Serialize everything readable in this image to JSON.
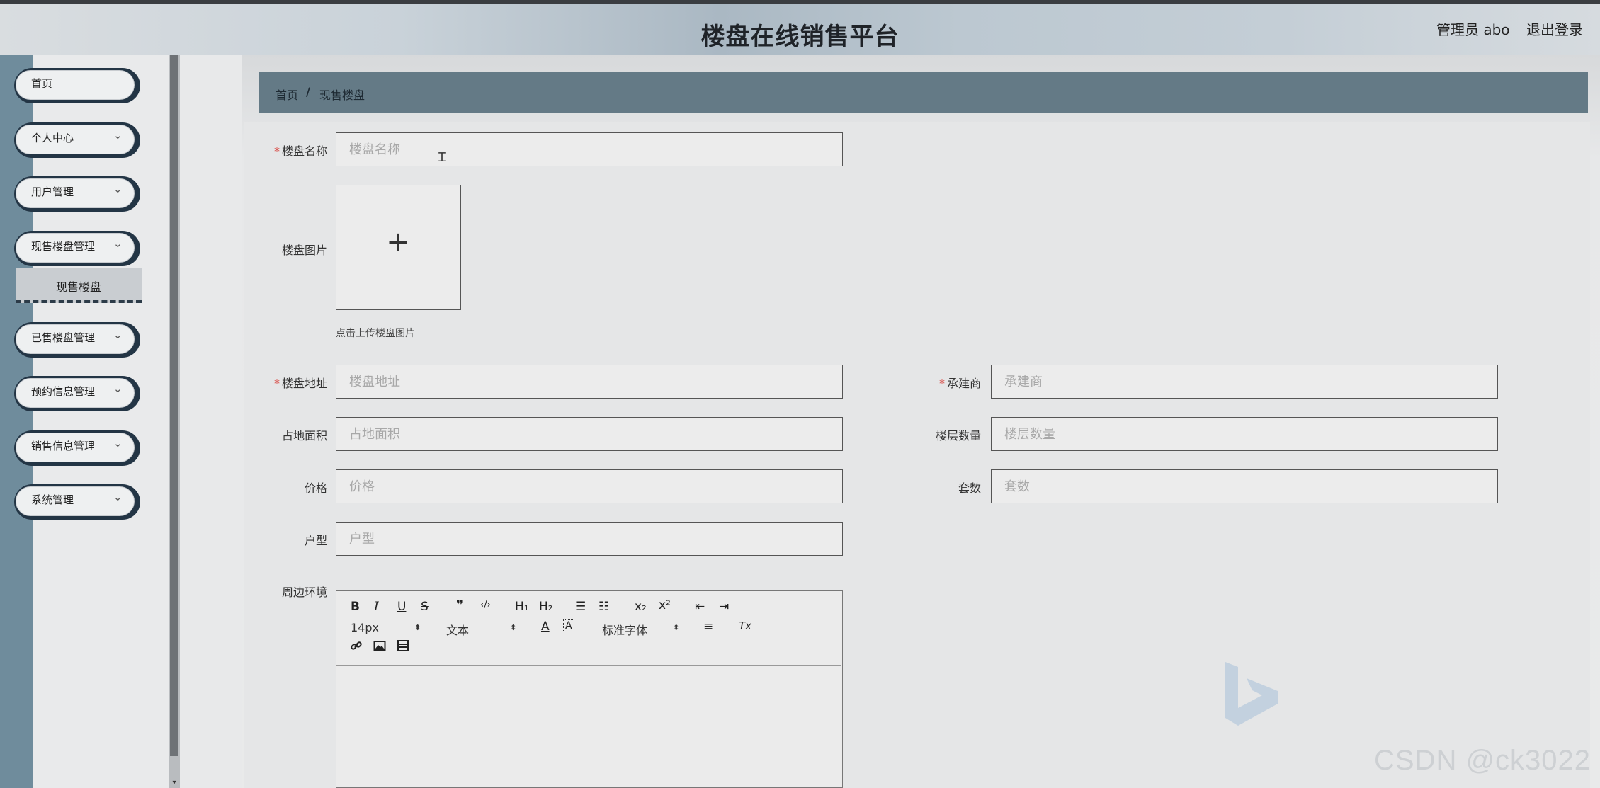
{
  "header": {
    "title": "楼盘在线销售平台",
    "user": "管理员 abo",
    "logout": "退出登录"
  },
  "sidebar": {
    "items": [
      {
        "label": "首页",
        "has_chevron": false
      },
      {
        "label": "个人中心",
        "has_chevron": true
      },
      {
        "label": "用户管理",
        "has_chevron": true
      },
      {
        "label": "现售楼盘管理",
        "has_chevron": true
      },
      {
        "label": "已售楼盘管理",
        "has_chevron": true
      },
      {
        "label": "预约信息管理",
        "has_chevron": true
      },
      {
        "label": "销售信息管理",
        "has_chevron": true
      },
      {
        "label": "系统管理",
        "has_chevron": true
      }
    ],
    "sub_item": "现售楼盘",
    "chevron_icon": "chevron-down-icon"
  },
  "breadcrumb": {
    "home": "首页",
    "separator": "/",
    "current": "现售楼盘"
  },
  "form": {
    "name": {
      "label": "楼盘名称",
      "placeholder": "楼盘名称",
      "required": true
    },
    "image": {
      "label": "楼盘图片",
      "hint": "点击上传楼盘图片",
      "plus": "+"
    },
    "address": {
      "label": "楼盘地址",
      "placeholder": "楼盘地址",
      "required": true
    },
    "contractor": {
      "label": "承建商",
      "placeholder": "承建商",
      "required": true
    },
    "area": {
      "label": "占地面积",
      "placeholder": "占地面积"
    },
    "floors": {
      "label": "楼层数量",
      "placeholder": "楼层数量"
    },
    "price": {
      "label": "价格",
      "placeholder": "价格"
    },
    "units": {
      "label": "套数",
      "placeholder": "套数"
    },
    "layout": {
      "label": "户型",
      "placeholder": "户型"
    },
    "surroundings": {
      "label": "周边环境"
    },
    "required_mark": "*"
  },
  "editor": {
    "font_size": "14px",
    "text_type": "文本",
    "font_family": "标准字体",
    "tools_row1": [
      "B",
      "I",
      "U",
      "S",
      "❞",
      "‹/›",
      "H₁",
      "H₂",
      "☰",
      "☷",
      "x₂",
      "x²",
      "⇤",
      "⇥"
    ],
    "tools_row2_extra": [
      "A",
      "A",
      "≡",
      "Tx"
    ]
  },
  "watermark": "CSDN @ck3022",
  "colors": {
    "accent_dark": "#233545",
    "breadcrumb_bg": "#647a86",
    "sidebar_strip": "#6f8c9c",
    "required": "#d9534f"
  }
}
